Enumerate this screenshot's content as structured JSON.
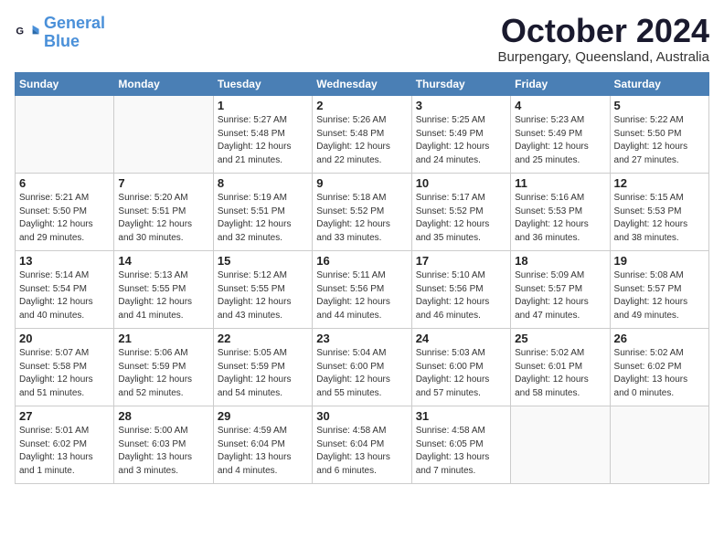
{
  "header": {
    "logo_line1": "General",
    "logo_line2": "Blue",
    "month": "October 2024",
    "location": "Burpengary, Queensland, Australia"
  },
  "days_of_week": [
    "Sunday",
    "Monday",
    "Tuesday",
    "Wednesday",
    "Thursday",
    "Friday",
    "Saturday"
  ],
  "weeks": [
    [
      {
        "day": "",
        "info": ""
      },
      {
        "day": "",
        "info": ""
      },
      {
        "day": "1",
        "info": "Sunrise: 5:27 AM\nSunset: 5:48 PM\nDaylight: 12 hours\nand 21 minutes."
      },
      {
        "day": "2",
        "info": "Sunrise: 5:26 AM\nSunset: 5:48 PM\nDaylight: 12 hours\nand 22 minutes."
      },
      {
        "day": "3",
        "info": "Sunrise: 5:25 AM\nSunset: 5:49 PM\nDaylight: 12 hours\nand 24 minutes."
      },
      {
        "day": "4",
        "info": "Sunrise: 5:23 AM\nSunset: 5:49 PM\nDaylight: 12 hours\nand 25 minutes."
      },
      {
        "day": "5",
        "info": "Sunrise: 5:22 AM\nSunset: 5:50 PM\nDaylight: 12 hours\nand 27 minutes."
      }
    ],
    [
      {
        "day": "6",
        "info": "Sunrise: 5:21 AM\nSunset: 5:50 PM\nDaylight: 12 hours\nand 29 minutes."
      },
      {
        "day": "7",
        "info": "Sunrise: 5:20 AM\nSunset: 5:51 PM\nDaylight: 12 hours\nand 30 minutes."
      },
      {
        "day": "8",
        "info": "Sunrise: 5:19 AM\nSunset: 5:51 PM\nDaylight: 12 hours\nand 32 minutes."
      },
      {
        "day": "9",
        "info": "Sunrise: 5:18 AM\nSunset: 5:52 PM\nDaylight: 12 hours\nand 33 minutes."
      },
      {
        "day": "10",
        "info": "Sunrise: 5:17 AM\nSunset: 5:52 PM\nDaylight: 12 hours\nand 35 minutes."
      },
      {
        "day": "11",
        "info": "Sunrise: 5:16 AM\nSunset: 5:53 PM\nDaylight: 12 hours\nand 36 minutes."
      },
      {
        "day": "12",
        "info": "Sunrise: 5:15 AM\nSunset: 5:53 PM\nDaylight: 12 hours\nand 38 minutes."
      }
    ],
    [
      {
        "day": "13",
        "info": "Sunrise: 5:14 AM\nSunset: 5:54 PM\nDaylight: 12 hours\nand 40 minutes."
      },
      {
        "day": "14",
        "info": "Sunrise: 5:13 AM\nSunset: 5:55 PM\nDaylight: 12 hours\nand 41 minutes."
      },
      {
        "day": "15",
        "info": "Sunrise: 5:12 AM\nSunset: 5:55 PM\nDaylight: 12 hours\nand 43 minutes."
      },
      {
        "day": "16",
        "info": "Sunrise: 5:11 AM\nSunset: 5:56 PM\nDaylight: 12 hours\nand 44 minutes."
      },
      {
        "day": "17",
        "info": "Sunrise: 5:10 AM\nSunset: 5:56 PM\nDaylight: 12 hours\nand 46 minutes."
      },
      {
        "day": "18",
        "info": "Sunrise: 5:09 AM\nSunset: 5:57 PM\nDaylight: 12 hours\nand 47 minutes."
      },
      {
        "day": "19",
        "info": "Sunrise: 5:08 AM\nSunset: 5:57 PM\nDaylight: 12 hours\nand 49 minutes."
      }
    ],
    [
      {
        "day": "20",
        "info": "Sunrise: 5:07 AM\nSunset: 5:58 PM\nDaylight: 12 hours\nand 51 minutes."
      },
      {
        "day": "21",
        "info": "Sunrise: 5:06 AM\nSunset: 5:59 PM\nDaylight: 12 hours\nand 52 minutes."
      },
      {
        "day": "22",
        "info": "Sunrise: 5:05 AM\nSunset: 5:59 PM\nDaylight: 12 hours\nand 54 minutes."
      },
      {
        "day": "23",
        "info": "Sunrise: 5:04 AM\nSunset: 6:00 PM\nDaylight: 12 hours\nand 55 minutes."
      },
      {
        "day": "24",
        "info": "Sunrise: 5:03 AM\nSunset: 6:00 PM\nDaylight: 12 hours\nand 57 minutes."
      },
      {
        "day": "25",
        "info": "Sunrise: 5:02 AM\nSunset: 6:01 PM\nDaylight: 12 hours\nand 58 minutes."
      },
      {
        "day": "26",
        "info": "Sunrise: 5:02 AM\nSunset: 6:02 PM\nDaylight: 13 hours\nand 0 minutes."
      }
    ],
    [
      {
        "day": "27",
        "info": "Sunrise: 5:01 AM\nSunset: 6:02 PM\nDaylight: 13 hours\nand 1 minute."
      },
      {
        "day": "28",
        "info": "Sunrise: 5:00 AM\nSunset: 6:03 PM\nDaylight: 13 hours\nand 3 minutes."
      },
      {
        "day": "29",
        "info": "Sunrise: 4:59 AM\nSunset: 6:04 PM\nDaylight: 13 hours\nand 4 minutes."
      },
      {
        "day": "30",
        "info": "Sunrise: 4:58 AM\nSunset: 6:04 PM\nDaylight: 13 hours\nand 6 minutes."
      },
      {
        "day": "31",
        "info": "Sunrise: 4:58 AM\nSunset: 6:05 PM\nDaylight: 13 hours\nand 7 minutes."
      },
      {
        "day": "",
        "info": ""
      },
      {
        "day": "",
        "info": ""
      }
    ]
  ]
}
